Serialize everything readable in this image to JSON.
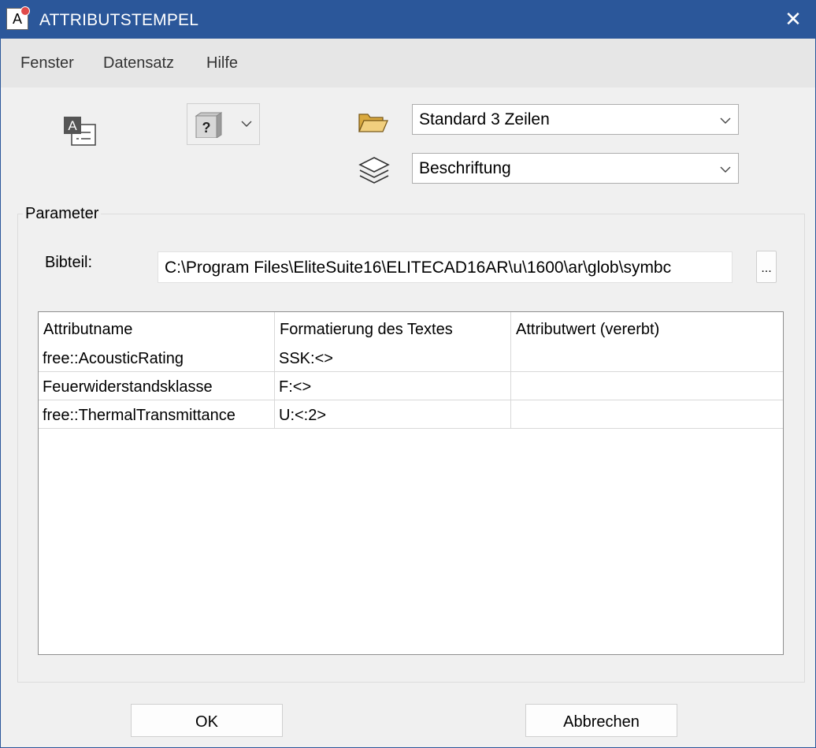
{
  "window": {
    "title": "ATTRIBUTSTEMPEL",
    "close_glyph": "✕",
    "app_icon_letter": "A"
  },
  "menu": {
    "items": [
      "Fenster",
      "Datensatz",
      "Hilfe"
    ]
  },
  "toolbar": {
    "text_attribute_icon_letter": "A",
    "icon_dropdown_glyph": "?",
    "template_combo_value": "Standard 3 Zeilen",
    "layer_combo_value": "Beschriftung"
  },
  "parameter": {
    "group_label": "Parameter",
    "bibteil_label": "Bibteil:",
    "bibteil_path": "C:\\Program Files\\EliteSuite16\\ELITECAD16AR\\u\\1600\\ar\\glob\\symbc",
    "browse_label": "..."
  },
  "table": {
    "headers": [
      "Attributname",
      "Formatierung des Textes",
      "Attributwert (vererbt)"
    ],
    "rows": [
      [
        "free::AcousticRating",
        "SSK:<>",
        ""
      ],
      [
        "Feuerwiderstandsklasse",
        "F:<>",
        ""
      ],
      [
        "free::ThermalTransmittance",
        "U:<:2>",
        ""
      ]
    ]
  },
  "buttons": {
    "ok": "OK",
    "cancel": "Abbrechen"
  },
  "colors": {
    "titlebar": "#2b579a",
    "menubar": "#e6e6e6",
    "window_bg": "#f0f0f0",
    "folder": "#e8c06a"
  }
}
